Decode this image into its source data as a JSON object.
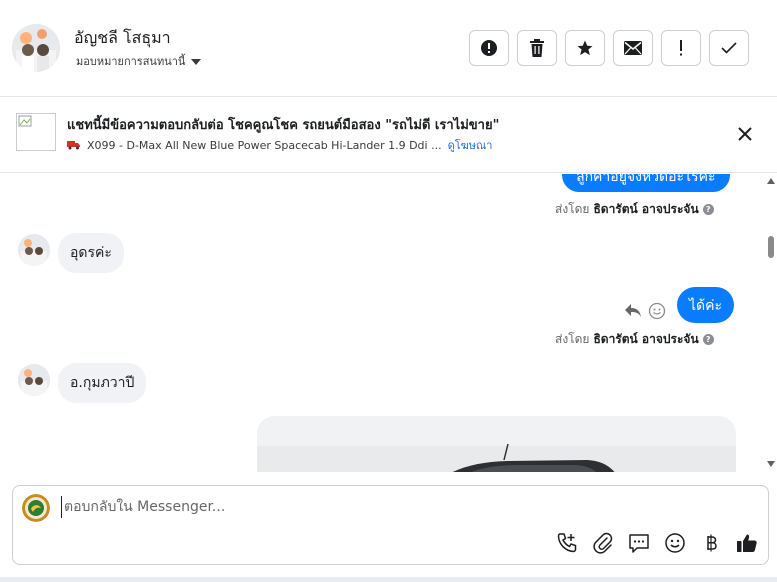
{
  "header": {
    "contact_name": "อัญชลี โสธุมา",
    "assign_label": "มอบหมายการสนทนานี้",
    "actions": [
      {
        "name": "report-button",
        "icon": "alert-circle-icon"
      },
      {
        "name": "delete-button",
        "icon": "trash-icon"
      },
      {
        "name": "star-button",
        "icon": "star-icon"
      },
      {
        "name": "mark-unread-button",
        "icon": "envelope-icon"
      },
      {
        "name": "priority-button",
        "icon": "exclamation-icon"
      },
      {
        "name": "done-button",
        "icon": "check-icon"
      }
    ]
  },
  "ad_banner": {
    "title": "แชทนี้มีข้อความตอบกลับต่อ โชคคูณโชค รถยนต์มือสอง \"รถไม่ดี เราไม่ขาย\"",
    "subtitle": "X099 - D-Max All New Blue Power Spacecab Hi-Lander 1.9 Ddi ...",
    "view_ad_link": "ดูโฆษณา"
  },
  "messages": {
    "outgoing_partial": "ลูกค้าอยู่จังหวัดอะไรคะ",
    "sent_by_prefix": "ส่งโดย",
    "sender_name": "ธิดารัตน์ อาจประจัน",
    "incoming_1": "อุดรค่ะ",
    "outgoing_2": "ได้ค่ะ",
    "incoming_2": "อ.กุมภวาปี"
  },
  "composer": {
    "placeholder": "ตอบกลับใน Messenger..."
  },
  "colors": {
    "accent": "#0a7cff",
    "link": "#216fdb",
    "bubble_in": "#f0f2f5"
  }
}
